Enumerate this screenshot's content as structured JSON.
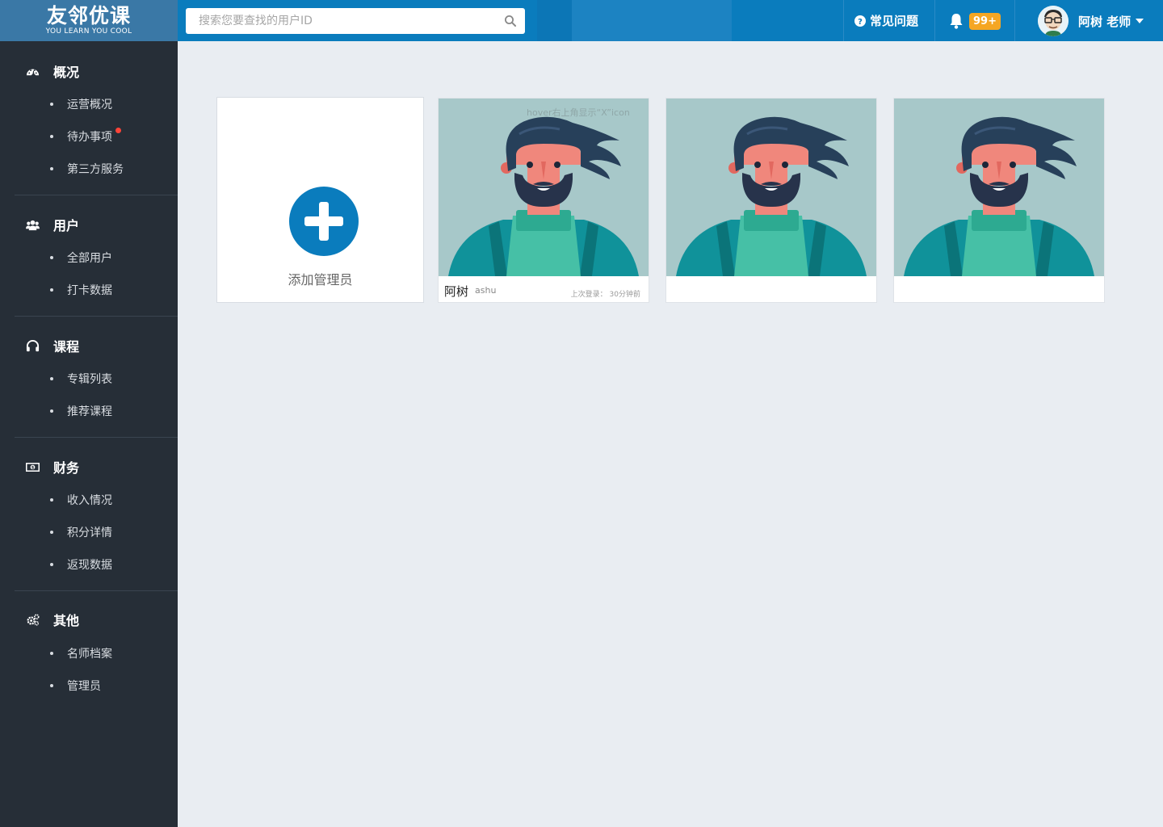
{
  "brand": {
    "logo_text": "友邻优课",
    "tagline": "YOU LEARN YOU COOL"
  },
  "search": {
    "placeholder": "搜索您要查找的用户ID",
    "value": ""
  },
  "header": {
    "faq_label": "常见问题",
    "notification_badge": "99+",
    "user_name": "阿树 老师"
  },
  "sidebar": {
    "groups": [
      {
        "label": "概况",
        "icon": "dashboard-icon",
        "items": [
          "运营概况",
          "待办事项",
          "第三方服务"
        ]
      },
      {
        "label": "用户",
        "icon": "users-icon",
        "items": [
          "全部用户",
          "打卡数据"
        ]
      },
      {
        "label": "课程",
        "icon": "headphones-icon",
        "items": [
          "专辑列表",
          "推荐课程"
        ]
      },
      {
        "label": "财务",
        "icon": "money-icon",
        "items": [
          "收入情况",
          "积分详情",
          "返现数据"
        ]
      },
      {
        "label": "其他",
        "icon": "cogs-icon",
        "items": [
          "名师档案",
          "管理员"
        ]
      }
    ],
    "unread_item": "待办事项"
  },
  "main": {
    "add_admin_label": "添加管理员",
    "hover_note": "hover右上角显示“X”icon",
    "admins": [
      {
        "name": "阿树",
        "id": "ashu",
        "last_login": "上次登录： 30分钟前"
      },
      {
        "name": "",
        "id": "",
        "last_login": ""
      },
      {
        "name": "",
        "id": "",
        "last_login": ""
      }
    ]
  },
  "colors": {
    "topbar": "#0a7cbd",
    "sidebar": "#262e37",
    "accent": "#0a7cbd",
    "badge": "#f5a623",
    "unread_dot": "#ff4438"
  }
}
